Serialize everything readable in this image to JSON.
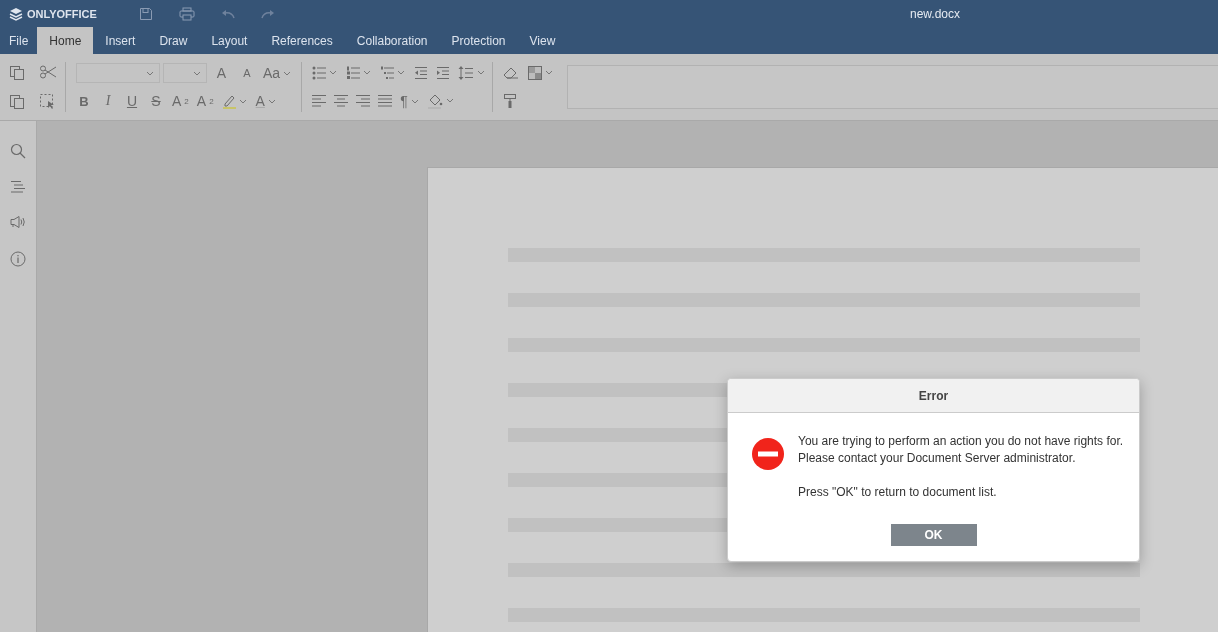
{
  "header": {
    "logo": "ONLYOFFICE",
    "title": "new.docx"
  },
  "tabs": [
    {
      "label": "File",
      "selected": false
    },
    {
      "label": "Home",
      "selected": true
    },
    {
      "label": "Insert",
      "selected": false
    },
    {
      "label": "Draw",
      "selected": false
    },
    {
      "label": "Layout",
      "selected": false
    },
    {
      "label": "References",
      "selected": false
    },
    {
      "label": "Collaboration",
      "selected": false
    },
    {
      "label": "Protection",
      "selected": false
    },
    {
      "label": "View",
      "selected": false
    }
  ],
  "toolbar": {
    "glyphs": [
      "A",
      "A",
      "Aa",
      "B",
      "I",
      "U",
      "S",
      "A",
      "A",
      "A",
      "¶"
    ],
    "superscript": "2",
    "subscript": "2"
  },
  "dialog": {
    "title": "Error",
    "message": [
      "You are trying to perform an action you do not have rights for.",
      "Please contact your Document Server administrator."
    ],
    "note": "Press \"OK\" to return to document list.",
    "button": "OK"
  }
}
